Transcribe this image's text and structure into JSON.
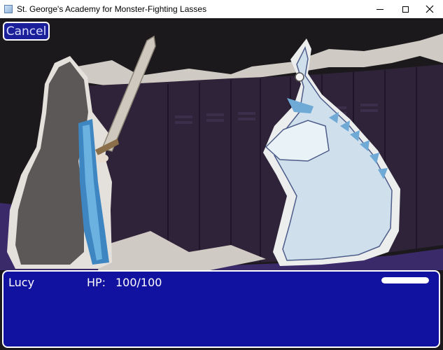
{
  "window": {
    "title": "St. George's Academy for Monster-Fighting Lasses",
    "controls": [
      "minimize-icon",
      "maximize-icon",
      "close-icon"
    ]
  },
  "battle": {
    "cancel_label": "Cancel",
    "party": [
      {
        "name": "Lucy",
        "hp_label": "HP:",
        "hp_value": "100/100",
        "atb_fill": 1.0
      }
    ]
  },
  "colors": {
    "panel_bg": "#1212a0",
    "panel_border": "#ffffff",
    "cancel_bg": "#1b1f9a",
    "lockers": "#2d2238",
    "robe": "#5a5656",
    "dragon": "#cfe0ec"
  }
}
